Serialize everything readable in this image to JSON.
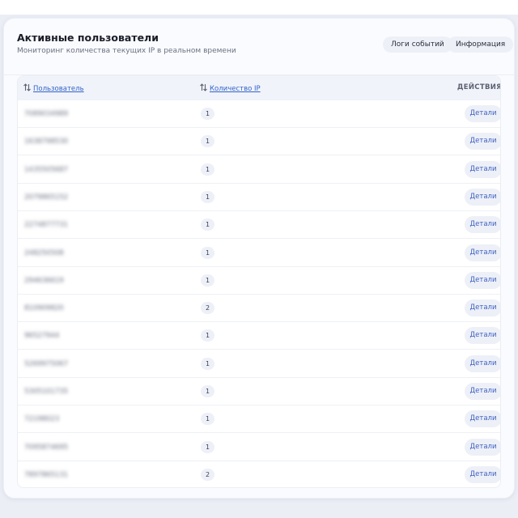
{
  "header": {
    "title": "Активные пользователи",
    "subtitle": "Мониторинг количества текущих IP в реальном времени",
    "buttons": {
      "logs": "Логи событий",
      "info": "Информация"
    }
  },
  "table": {
    "columns": {
      "user": "Пользователь",
      "ip_count": "Количество IP",
      "actions": "ДЕЙСТВИЯ"
    },
    "details_label": "Детали",
    "rows": [
      {
        "user": "7089034989",
        "ip_count": "1"
      },
      {
        "user": "1638798530",
        "ip_count": "1"
      },
      {
        "user": "1435505687",
        "ip_count": "1"
      },
      {
        "user": "2079865152",
        "ip_count": "1"
      },
      {
        "user": "2274877731",
        "ip_count": "1"
      },
      {
        "user": "248250508",
        "ip_count": "1"
      },
      {
        "user": "294636619",
        "ip_count": "1"
      },
      {
        "user": "810909820",
        "ip_count": "2"
      },
      {
        "user": "96527944",
        "ip_count": "1"
      },
      {
        "user": "5269975067",
        "ip_count": "1"
      },
      {
        "user": "5305101735",
        "ip_count": "1"
      },
      {
        "user": "72198023",
        "ip_count": "1"
      },
      {
        "user": "7095874695",
        "ip_count": "1"
      },
      {
        "user": "7897865131",
        "ip_count": "2"
      }
    ]
  },
  "colors": {
    "accent": "#2f63c7",
    "badge_bg": "#eef0f8",
    "card_bg": "#fafbfe"
  }
}
